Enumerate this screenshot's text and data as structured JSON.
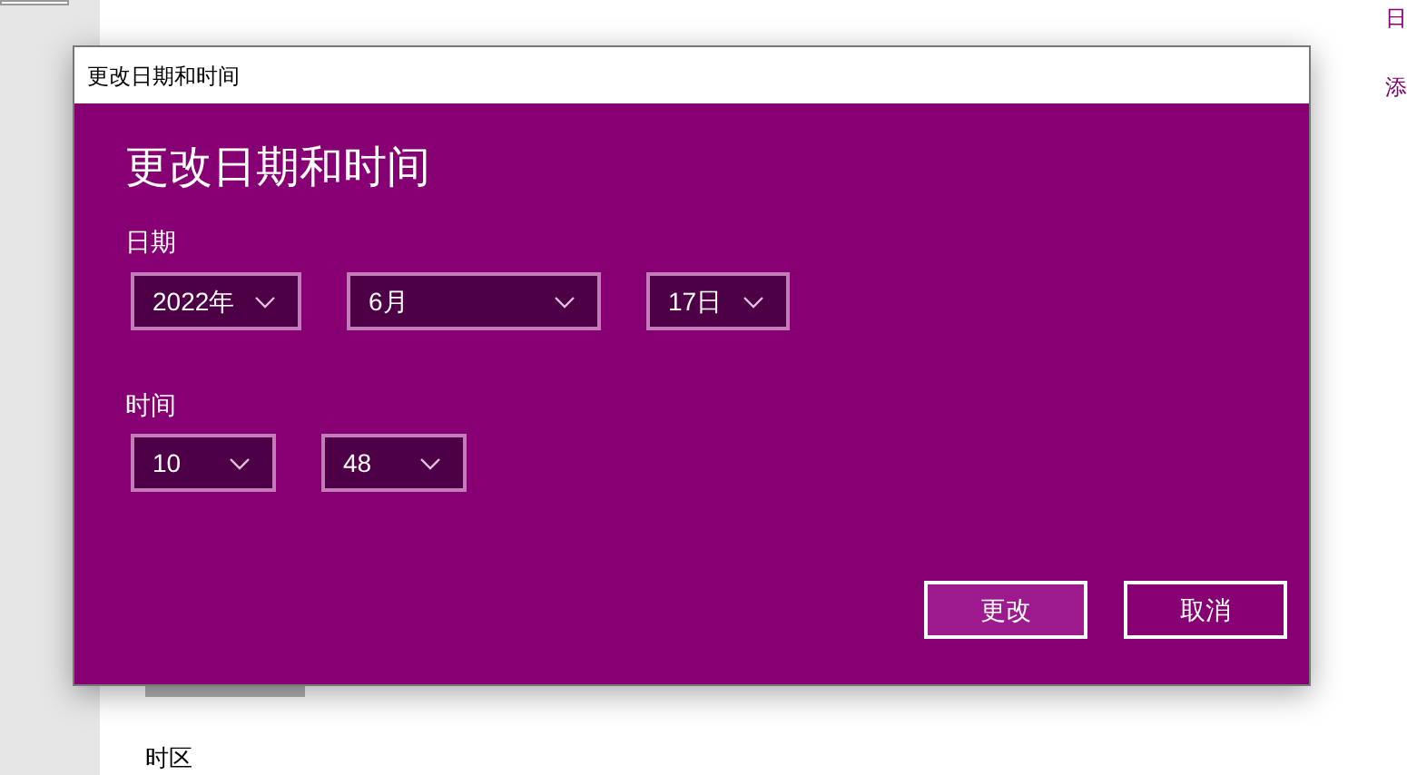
{
  "background": {
    "side_links": [
      "日",
      "添"
    ],
    "timezone_label": "时区"
  },
  "dialog": {
    "title": "更改日期和时间",
    "heading": "更改日期和时间",
    "date_label": "日期",
    "date_fields": [
      {
        "value": "2022年"
      },
      {
        "value": "6月"
      },
      {
        "value": "17日"
      }
    ],
    "time_label": "时间",
    "time_fields": [
      {
        "value": "10"
      },
      {
        "value": "48"
      }
    ],
    "buttons": [
      {
        "label": "更改",
        "kind": "primary"
      },
      {
        "label": "取消",
        "kind": "secondary"
      }
    ]
  }
}
